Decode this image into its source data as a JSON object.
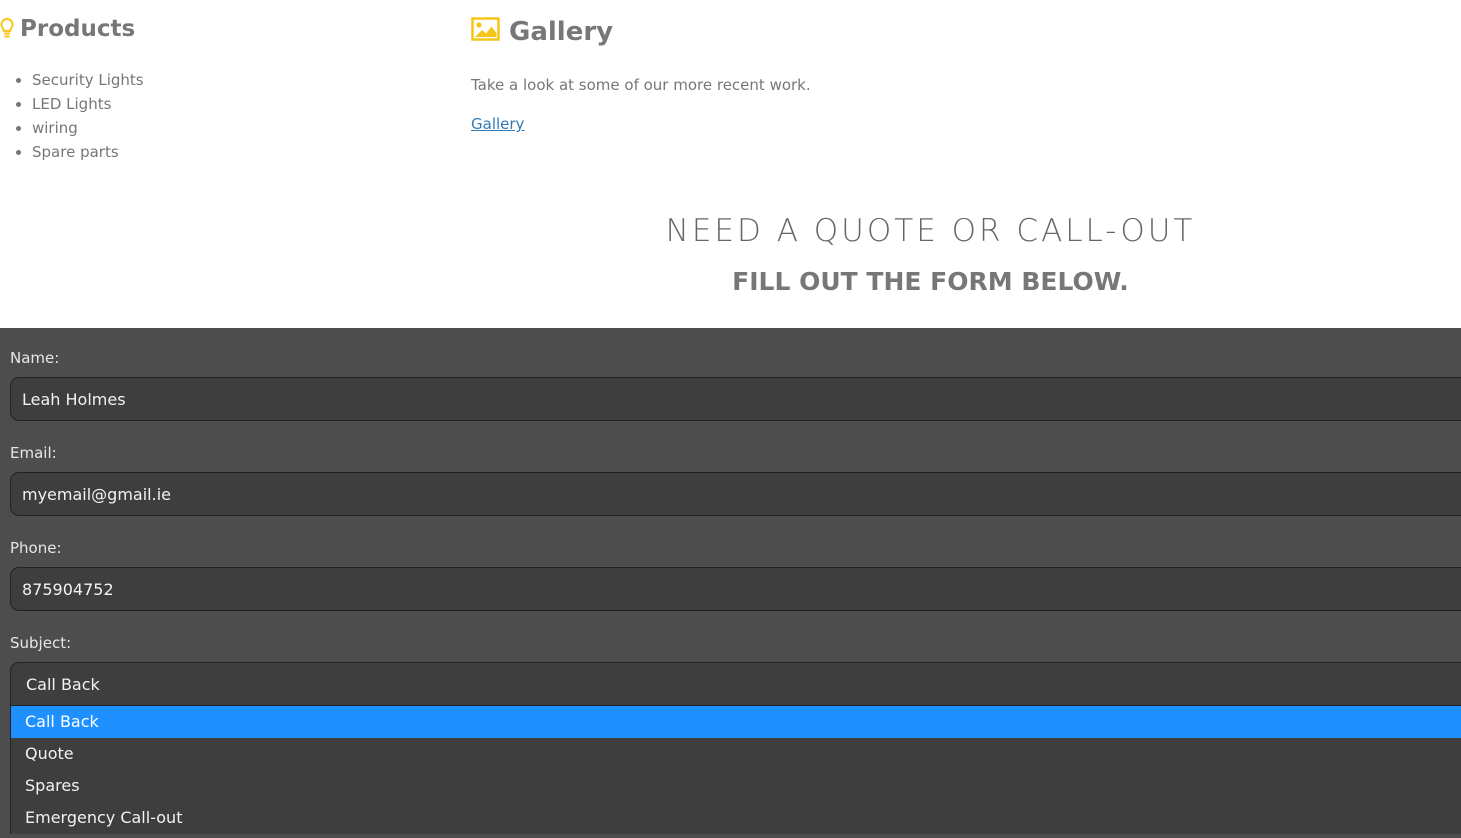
{
  "products": {
    "title": "Products",
    "items": [
      "Security Lights",
      "LED Lights",
      "wiring",
      "Spare parts"
    ]
  },
  "gallery": {
    "title": "Gallery",
    "description": "Take a look at some of our more recent work.",
    "link": "Gallery"
  },
  "quote": {
    "heading": "NEED A QUOTE OR CALL-OUT",
    "subheading": "FILL OUT THE FORM BELOW."
  },
  "form": {
    "name_label": "Name:",
    "name_value": "Leah Holmes",
    "email_label": "Email:",
    "email_value": "myemail@gmail.ie",
    "phone_label": "Phone:",
    "phone_value": "875904752",
    "subject_label": "Subject:",
    "subject_value": "Call Back",
    "subject_options": [
      "Call Back",
      "Quote",
      "Spares",
      "Emergency Call-out"
    ]
  },
  "colors": {
    "accent_yellow": "#f5c518",
    "form_background": "#4d4d4d",
    "field_background": "#3e3e3e",
    "selected_option": "#1e90ff",
    "link": "#337ab7"
  },
  "icons": {
    "products": "lightbulb-icon",
    "gallery": "image-icon"
  }
}
